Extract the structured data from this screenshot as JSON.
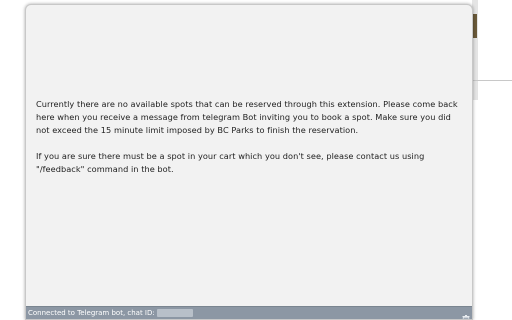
{
  "message": {
    "no_spots": "Currently there are no available spots that can be reserved through this extension. Please come back here when you receive a message from telegram Bot inviting you to book a spot. Make sure you did not exceed the 15 minute limit imposed by BC Parks to finish the reservation.",
    "contact": "If you are sure there must be a spot in your cart which you don't see, please contact us using \"/feedback\" command in the bot."
  },
  "status_bar": {
    "connection_label": "Connected to Telegram bot, chat ID:",
    "trash_icon": "trash-icon"
  }
}
